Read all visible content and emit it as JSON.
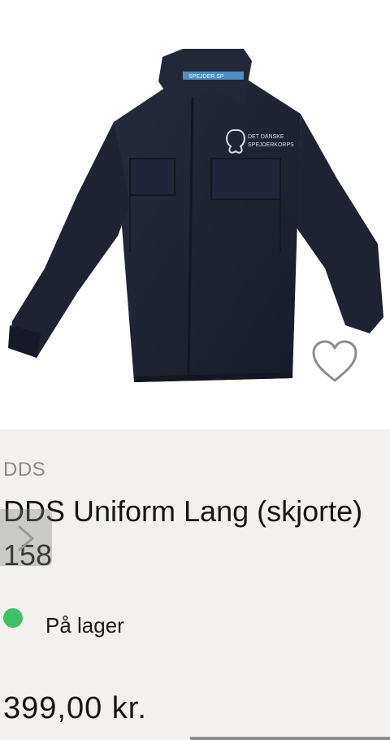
{
  "product": {
    "brand": "DDS",
    "title": "DDS Uniform Lang (skjorte) 158",
    "stock_text": "På lager",
    "price": "399,00 kr.",
    "image_collar_label": "SPEJDER SP",
    "image_logo_text_1": "DET DANSKE",
    "image_logo_text_2": "SPEJDERKORPS"
  },
  "icons": {
    "favorite": "heart-outline-icon",
    "carousel_next": "chevron-right-icon"
  },
  "colors": {
    "stock_indicator": "#3cc265",
    "jacket": "#1f2433"
  }
}
